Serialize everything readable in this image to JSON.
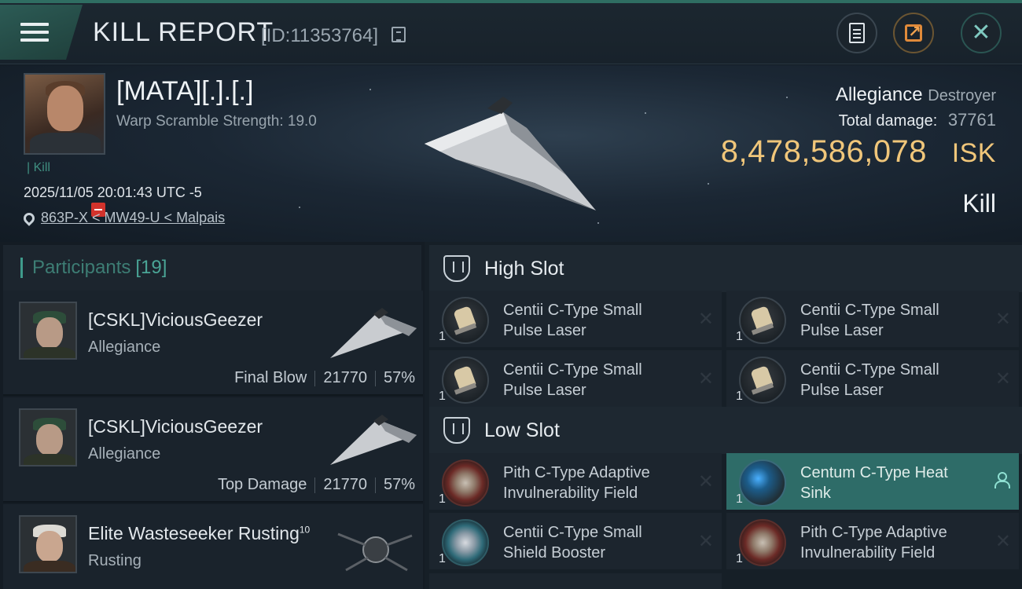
{
  "header": {
    "title": "KILL REPORT",
    "report_id": "[ID:11353764]",
    "icons": [
      "menu-icon",
      "copy-icon",
      "notes-icon",
      "share-icon",
      "close-icon"
    ],
    "close_glyph": "✕",
    "accent_color": "#2f6d62"
  },
  "victim": {
    "name": "[MATA][.].[.]",
    "warp_scramble": "Warp Scramble Strength: 19.0",
    "tag": "| Kill",
    "datetime": "2025/11/05 20:01:43 UTC -5",
    "location": "863P-X < MW49-U < Malpais",
    "ship_class_name": "Allegiance",
    "ship_class_type": "Destroyer",
    "total_damage_label": "Total damage:",
    "total_damage_value": "37761",
    "isk_value": "8,478,586,078",
    "isk_unit": "ISK",
    "result": "Kill",
    "isk_color": "#f0c67a"
  },
  "participants": {
    "label": "Participants",
    "count": "[19]",
    "rows": [
      {
        "name": "[CSKL]ViciousGeezer",
        "ship": "Allegiance",
        "role": "Final Blow",
        "damage": "21770",
        "percent": "57%"
      },
      {
        "name": "[CSKL]ViciousGeezer",
        "ship": "Allegiance",
        "role": "Top Damage",
        "damage": "21770",
        "percent": "57%"
      },
      {
        "name": "Elite Wasteseeker Rusting",
        "level": "10",
        "ship": "Rusting"
      }
    ]
  },
  "fitting": {
    "high_slot_label": "High Slot",
    "low_slot_label": "Low Slot",
    "high": [
      {
        "line1": "Centii C-Type Small",
        "line2": "Pulse Laser",
        "qty": "1"
      },
      {
        "line1": "Centii C-Type Small",
        "line2": "Pulse Laser",
        "qty": "1"
      },
      {
        "line1": "Centii C-Type Small",
        "line2": "Pulse Laser",
        "qty": "1"
      },
      {
        "line1": "Centii C-Type Small",
        "line2": "Pulse Laser",
        "qty": "1"
      }
    ],
    "low": [
      {
        "line1": "Pith C-Type Adaptive",
        "line2": "Invulnerability Field",
        "qty": "1"
      },
      {
        "line1": "Centum C-Type Heat",
        "line2": "Sink",
        "qty": "1"
      },
      {
        "line1": "Centii C-Type Small",
        "line2": "Shield Booster",
        "qty": "1"
      },
      {
        "line1": "Pith C-Type Adaptive",
        "line2": "Invulnerability Field",
        "qty": "1"
      }
    ],
    "destroyed_glyph": "✕",
    "highlight_color": "#2e6c68"
  }
}
